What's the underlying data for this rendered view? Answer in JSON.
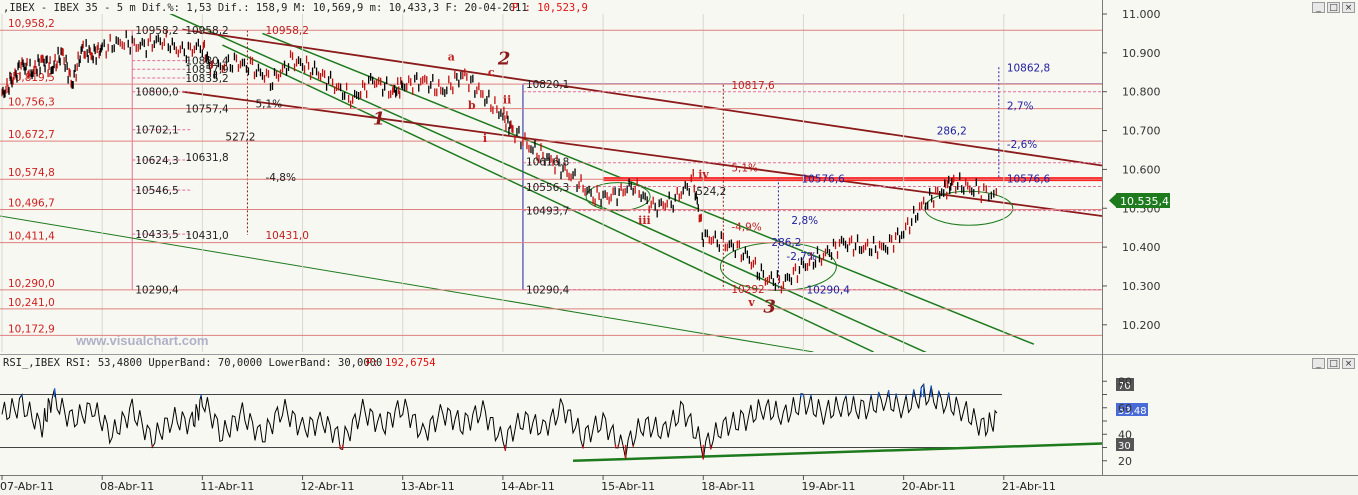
{
  "colors": {
    "background": "#f4f4ee",
    "price_bar": "#000000",
    "channel_green": "#1d7a1d",
    "resistance_red": "#ff2020",
    "trend_maroon": "#8b1a1a",
    "fib_line": "#e0709a",
    "blue_ref": "#2020a0",
    "rsi_line": "#000000",
    "rsi_down": "#e01010",
    "rsi_up": "#1060e0",
    "ellipse": "#1d7a1d",
    "price_badge": "#1d7a1d"
  },
  "price_panel": {
    "header": ",IBEX - IBEX 35 -  5 m Dif.%: 1,53 Dif.: 158,9 M: 10,569,9 m: 10,433,3 F: 20-04-2011",
    "header_p": "P : 10,523,9",
    "watermark": "www.visualchart.com",
    "current_price": "10.535,4",
    "window_buttons": [
      "_",
      "□",
      "×"
    ]
  },
  "rsi_panel": {
    "header": "RSI_,IBEX RSI: 53,4800 UpperBand: 70,0000 LowerBand: 30,0000",
    "header_p": "P: 192,6754",
    "current_value": "53,48",
    "upper_band_label": "70",
    "lower_band_label": "30",
    "window_buttons": [
      "_",
      "□",
      "×"
    ]
  },
  "chart_data": [
    {
      "type": "line",
      "title": "",
      "instrument": "IBEX 35 - 5 m",
      "xlabel": "",
      "ylabel": "",
      "x_ticks": [
        "07-Abr-11",
        "08-Abr-11",
        "11-Abr-11",
        "12-Abr-11",
        "13-Abr-11",
        "14-Abr-11",
        "15-Abr-11",
        "18-Abr-11",
        "19-Abr-11",
        "20-Abr-11",
        "21-Abr-11"
      ],
      "ylim": [
        10130,
        11000
      ],
      "y_ticks": [
        11000,
        10900,
        10800,
        10700,
        10600,
        10500,
        10400,
        10300,
        10200
      ],
      "y_tick_labels": [
        "11.000",
        "10.900",
        "10.800",
        "10.700",
        "10.600",
        "10.500",
        "10.400",
        "10.300",
        "10.200"
      ],
      "series": [
        {
          "x": [
            0,
            0.1,
            0.2,
            0.3,
            0.4,
            0.5,
            0.6,
            0.7,
            0.8,
            0.9,
            1.0,
            1.2,
            1.4,
            1.6,
            1.8,
            2.0,
            2.1,
            2.3,
            2.5,
            2.7,
            2.9,
            3.1,
            3.3,
            3.5,
            3.7,
            3.9,
            4.0,
            4.2,
            4.4,
            4.6,
            4.8,
            5.0,
            5.1,
            5.3,
            5.5,
            5.7,
            5.9,
            6.1,
            6.3,
            6.5,
            6.7,
            6.9,
            7.0,
            7.2,
            7.4,
            7.6,
            7.8,
            8.0,
            8.2,
            8.4,
            8.6,
            8.8,
            9.0,
            9.2,
            9.4,
            9.5,
            9.7,
            9.95
          ],
          "values": [
            10790,
            10830,
            10870,
            10850,
            10880,
            10860,
            10900,
            10820,
            10910,
            10895,
            10910,
            10930,
            10915,
            10935,
            10900,
            10920,
            10850,
            10880,
            10860,
            10830,
            10880,
            10860,
            10820,
            10780,
            10830,
            10800,
            10815,
            10830,
            10800,
            10845,
            10790,
            10740,
            10700,
            10650,
            10620,
            10580,
            10530,
            10530,
            10560,
            10500,
            10520,
            10570,
            10430,
            10410,
            10390,
            10320,
            10310,
            10350,
            10380,
            10410,
            10400,
            10395,
            10440,
            10510,
            10550,
            10565,
            10550,
            10530
          ]
        }
      ],
      "price_levels": [
        {
          "value": 10958.2,
          "label": "10,958,2"
        },
        {
          "value": 10819.5,
          "label": "10,819,5"
        },
        {
          "value": 10756.3,
          "label": "10,756,3"
        },
        {
          "value": 10672.7,
          "label": "10,672,7"
        },
        {
          "value": 10574.8,
          "label": "10,574,8"
        },
        {
          "value": 10496.7,
          "label": "10,496,7"
        },
        {
          "value": 10411.4,
          "label": "10,411,4"
        },
        {
          "value": 10290.0,
          "label": "10,290,0"
        },
        {
          "value": 10241.0,
          "label": "10,241,0"
        },
        {
          "value": 10172.9,
          "label": "10,172,9"
        }
      ],
      "left_box_labels": [
        {
          "x": 1.3,
          "value": 10958.2,
          "label": "10958,2"
        },
        {
          "x": 1.3,
          "value": 10800.0,
          "label": "10800,0"
        },
        {
          "x": 1.3,
          "value": 10702.1,
          "label": "10702,1"
        },
        {
          "x": 1.3,
          "value": 10624.3,
          "label": "10624,3"
        },
        {
          "x": 1.3,
          "value": 10546.5,
          "label": "10546,5"
        },
        {
          "x": 1.3,
          "value": 10433.5,
          "label": "10433,5"
        },
        {
          "x": 1.3,
          "value": 10290.4,
          "label": "10290,4"
        },
        {
          "x": 1.8,
          "value": 10958.2,
          "label": "10958,2"
        },
        {
          "x": 1.8,
          "value": 10880.4,
          "label": "10880,4"
        },
        {
          "x": 1.8,
          "value": 10857.9,
          "label": "10857,9"
        },
        {
          "x": 1.8,
          "value": 10835.2,
          "label": "10835,2"
        },
        {
          "x": 1.8,
          "value": 10757.4,
          "label": "10757,4"
        },
        {
          "x": 1.8,
          "value": 10631.8,
          "label": "10631,8"
        },
        {
          "x": 1.8,
          "value": 10431.0,
          "label": "10431,0"
        }
      ],
      "annotations_text": [
        {
          "x": 2.6,
          "value": 10958.2,
          "label": "10958,2",
          "color": "#c02020"
        },
        {
          "x": 2.2,
          "value": 10685,
          "label": "527,2",
          "color": "#202020"
        },
        {
          "x": 2.6,
          "value": 10580,
          "label": "-4,8%",
          "color": "#202020"
        },
        {
          "x": 2.6,
          "value": 10431,
          "label": "10431,0",
          "color": "#c02020"
        },
        {
          "x": 2.5,
          "value": 10770,
          "label": "5,1%",
          "color": "#202020"
        },
        {
          "x": 5.2,
          "value": 10820.1,
          "label": "10820,1",
          "color": "#202020"
        },
        {
          "x": 5.2,
          "value": 10620,
          "label": "10616,8",
          "color": "#202020"
        },
        {
          "x": 5.2,
          "value": 10555,
          "label": "10556,3",
          "color": "#202020"
        },
        {
          "x": 5.2,
          "value": 10493.7,
          "label": "10493,7",
          "color": "#202020"
        },
        {
          "x": 5.2,
          "value": 10290.4,
          "label": "10290,4",
          "color": "#202020"
        },
        {
          "x": 7.25,
          "value": 10817.6,
          "label": "10817,6",
          "color": "#c02020"
        },
        {
          "x": 7.25,
          "value": 10605,
          "label": "5,1%",
          "color": "#c02020"
        },
        {
          "x": 7.25,
          "value": 10453,
          "label": "-4,9%",
          "color": "#c02020"
        },
        {
          "x": 7.25,
          "value": 10292,
          "label": "10292",
          "color": "#c02020"
        },
        {
          "x": 6.9,
          "value": 10545,
          "label": "524,2",
          "color": "#202020"
        },
        {
          "x": 7.65,
          "value": 10413,
          "label": "286,2",
          "color": "#2020a0"
        },
        {
          "x": 7.85,
          "value": 10470,
          "label": "2,8%",
          "color": "#2020a0"
        },
        {
          "x": 7.8,
          "value": 10377,
          "label": "-2,7%",
          "color": "#2020a0"
        },
        {
          "x": 7.95,
          "value": 10576.6,
          "label": "10576,6",
          "color": "#2020a0"
        },
        {
          "x": 8.0,
          "value": 10290.4,
          "label": "10290,4",
          "color": "#2020a0"
        },
        {
          "x": 9.3,
          "value": 10700,
          "label": "286,2",
          "color": "#2020a0"
        },
        {
          "x": 10.0,
          "value": 10862.8,
          "label": "10862,8",
          "color": "#2020a0"
        },
        {
          "x": 10.0,
          "value": 10765,
          "label": "2,7%",
          "color": "#2020a0"
        },
        {
          "x": 10.0,
          "value": 10665,
          "label": "-2,6%",
          "color": "#2020a0"
        },
        {
          "x": 10.0,
          "value": 10576.6,
          "label": "10576,6",
          "color": "#2020a0"
        }
      ],
      "wave_labels": [
        {
          "x": 3.7,
          "value": 10715,
          "label": "1",
          "color": "#8b1a1a",
          "size": "big"
        },
        {
          "x": 4.95,
          "value": 10870,
          "label": "2",
          "color": "#8b1a1a",
          "size": "big"
        },
        {
          "x": 7.6,
          "value": 10232,
          "label": "3",
          "color": "#8b1a1a",
          "size": "big"
        },
        {
          "x": 4.45,
          "value": 10880,
          "label": "a",
          "color": "#c02020",
          "size": "small"
        },
        {
          "x": 4.65,
          "value": 10755,
          "label": "b",
          "color": "#c02020",
          "size": "small"
        },
        {
          "x": 4.85,
          "value": 10840,
          "label": "c",
          "color": "#c02020",
          "size": "small"
        },
        {
          "x": 4.8,
          "value": 10670,
          "label": "i",
          "color": "#c02020",
          "size": "small"
        },
        {
          "x": 5.0,
          "value": 10770,
          "label": "ii",
          "color": "#c02020",
          "size": "small"
        },
        {
          "x": 6.35,
          "value": 10460,
          "label": "iii",
          "color": "#c02020",
          "size": "small"
        },
        {
          "x": 6.95,
          "value": 10578,
          "label": "iv",
          "color": "#c02020",
          "size": "small"
        },
        {
          "x": 7.45,
          "value": 10248,
          "label": "v",
          "color": "#c02020",
          "size": "small"
        }
      ]
    },
    {
      "type": "line",
      "title": "RSI",
      "xlabel": "",
      "ylabel": "",
      "ylim": [
        10,
        90
      ],
      "y_ticks": [
        80,
        70,
        60,
        50,
        40,
        30,
        20
      ],
      "y_tick_labels": [
        "80",
        "70",
        "60",
        "50",
        "40",
        "30",
        "20"
      ],
      "upper_band": 70,
      "lower_band": 30,
      "current_value": 53.48,
      "series": [
        {
          "x": [
            0,
            0.2,
            0.4,
            0.5,
            0.7,
            0.9,
            1.1,
            1.3,
            1.5,
            1.7,
            1.9,
            2.0,
            2.2,
            2.4,
            2.6,
            2.8,
            3.0,
            3.2,
            3.4,
            3.6,
            3.8,
            4.0,
            4.2,
            4.4,
            4.6,
            4.8,
            5.0,
            5.2,
            5.4,
            5.6,
            5.8,
            6.0,
            6.2,
            6.4,
            6.6,
            6.8,
            7.0,
            7.2,
            7.4,
            7.6,
            7.8,
            8.0,
            8.2,
            8.4,
            8.6,
            8.8,
            9.0,
            9.2,
            9.4,
            9.6,
            9.8,
            9.95
          ],
          "values": [
            55,
            62,
            45,
            68,
            50,
            60,
            40,
            58,
            36,
            52,
            48,
            66,
            40,
            55,
            38,
            60,
            44,
            50,
            35,
            58,
            46,
            62,
            40,
            56,
            48,
            58,
            34,
            52,
            44,
            60,
            38,
            50,
            28,
            48,
            42,
            58,
            30,
            46,
            50,
            60,
            54,
            64,
            56,
            62,
            58,
            66,
            60,
            70,
            64,
            58,
            44,
            53.48
          ]
        }
      ]
    }
  ]
}
